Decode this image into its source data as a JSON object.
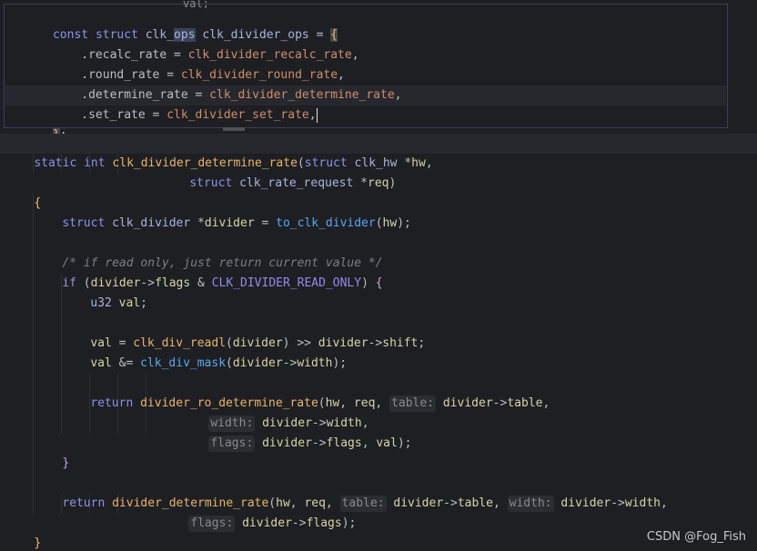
{
  "peek": {
    "bleed_text": "val;",
    "lines": [
      [
        "const ",
        "struct ",
        "clk_",
        "ops",
        " clk_divider_ops",
        " = ",
        "{"
      ],
      [
        "    .recalc_rate",
        " = ",
        "clk_divider_recalc_rate",
        ","
      ],
      [
        "    .round_rate",
        " = ",
        "clk_divider_round_rate",
        ","
      ],
      [
        "    .determine_rate",
        " = ",
        "clk_divider_determine_rate",
        ","
      ],
      [
        "    .set_rate",
        " = ",
        "clk_divider_set_rate",
        ","
      ],
      [
        "}",
        ";"
      ]
    ]
  },
  "code": {
    "l1": [
      "static ",
      "int ",
      "clk_divider_determine_rate",
      "(",
      "struct ",
      "clk_hw",
      " *",
      "hw",
      ","
    ],
    "l2": [
      "struct ",
      "clk_rate_request",
      " *",
      "req",
      ")"
    ],
    "l3": [
      "{"
    ],
    "l4": [
      "struct ",
      "clk_divider",
      " *",
      "divider",
      " = ",
      "to_clk_divider",
      "(",
      "hw",
      ");"
    ],
    "l5": [
      "/* if read only, just return current value */"
    ],
    "l6": [
      "if ",
      "(",
      "divider",
      "->",
      "flags",
      " & ",
      "CLK_DIVIDER_READ_ONLY",
      ") ",
      "{"
    ],
    "l7": [
      "u32 ",
      "val",
      ";"
    ],
    "l8": [
      "val",
      " = ",
      "clk_div_readl",
      "(",
      "divider",
      ") ",
      ">> ",
      "divider",
      "->",
      "shift",
      ";"
    ],
    "l9": [
      "val",
      " &= ",
      "clk_div_mask",
      "(",
      "divider",
      "->",
      "width",
      ");"
    ],
    "l10": [
      "return ",
      "divider_ro_determine_rate",
      "(",
      "hw",
      ", ",
      "req",
      ", ",
      "table:",
      " divider",
      "->",
      "table",
      ","
    ],
    "l11": [
      "width:",
      " divider",
      "->",
      "width",
      ","
    ],
    "l12": [
      "flags:",
      " divider",
      "->",
      "flags",
      ", ",
      "val",
      ");"
    ],
    "l13": [
      "}"
    ],
    "l14": [
      "return ",
      "divider_determine_rate",
      "(",
      "hw",
      ", ",
      "req",
      ", ",
      "table:",
      " divider",
      "->",
      "table",
      ", ",
      "width:",
      " divider",
      "->",
      "width",
      ","
    ],
    "l15": [
      "flags:",
      " divider",
      "->",
      "flags",
      ");"
    ],
    "l16": [
      "}"
    ]
  },
  "watermark": "CSDN @Fog_Fish"
}
